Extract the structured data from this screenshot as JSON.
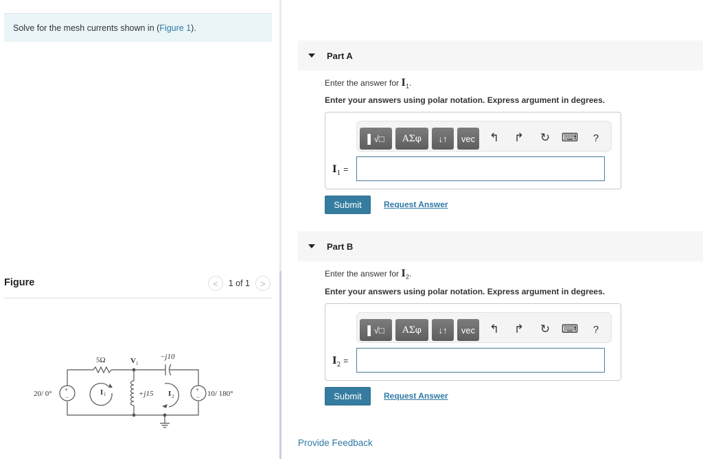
{
  "prompt": {
    "text_before": "Solve for the mesh currents shown in (",
    "link": "Figure 1",
    "text_after": ")."
  },
  "figure": {
    "title": "Figure",
    "pager": {
      "prev_icon": "chevron-left-icon",
      "label": "1 of 1",
      "next_icon": "chevron-right-icon"
    },
    "circuit": {
      "source_left": "20/ 0°",
      "resistor": "5Ω",
      "node": "V",
      "node_sub": "1",
      "capacitor": "−j10",
      "inductor": "+j15",
      "mesh1": "I",
      "mesh1_sub": "1",
      "mesh2": "I",
      "mesh2_sub": "2",
      "source_right": "10/ 180°",
      "plus": "+",
      "minus": "−"
    }
  },
  "parts": [
    {
      "title": "Part A",
      "enter_for": "Enter the answer for ",
      "var": "I",
      "var_sub": "1",
      "instruction": "Enter your answers using polar notation. Express argument in degrees.",
      "label_eq": "=",
      "input_value": "",
      "submit": "Submit",
      "request": "Request Answer"
    },
    {
      "title": "Part B",
      "enter_for": "Enter the answer for ",
      "var": "I",
      "var_sub": "2",
      "instruction": "Enter your answers using polar notation. Express argument in degrees.",
      "label_eq": "=",
      "input_value": "",
      "submit": "Submit",
      "request": "Request Answer"
    }
  ],
  "toolbar": {
    "templates": "▌√□",
    "greek": "ΑΣφ",
    "arrows": "↓↑",
    "vec": "vec",
    "undo_icon": "↰",
    "redo_icon": "↱",
    "reset_icon": "↻",
    "keyboard_icon": "⌨",
    "help": "?"
  },
  "feedback": "Provide Feedback"
}
